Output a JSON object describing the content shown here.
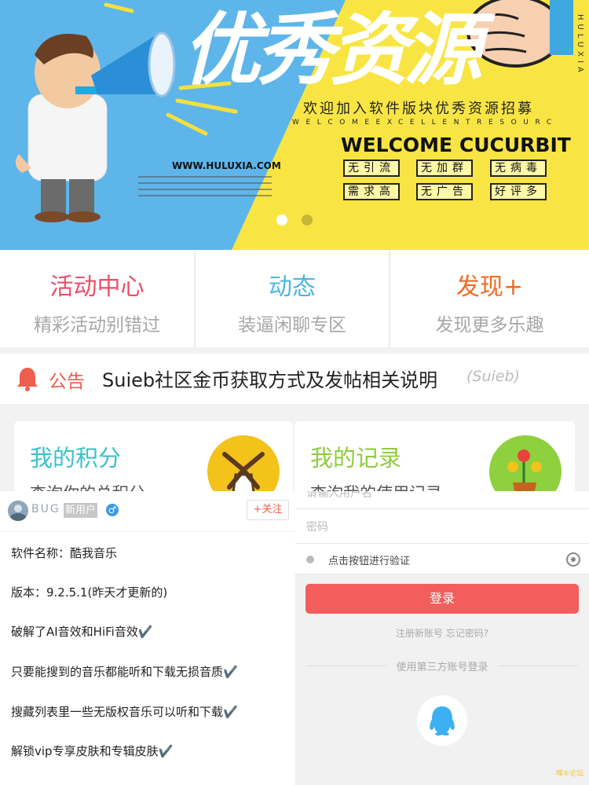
{
  "banner": {
    "title": "优秀资源",
    "side_text": "HULUXIA",
    "welcome_cn": "欢迎加入软件版块优秀资源招募",
    "welcome_en_spaced": "WELCOMEEXCELLENTRESOURC",
    "welcome_en": "WELCOME CUCURBIT",
    "site": "WWW.HULUXIA.COM",
    "tags": [
      "无引流",
      "无加群",
      "无病毒",
      "需求高",
      "无广告",
      "好评多"
    ],
    "active_slide": 1,
    "slide_count": 2,
    "colors": {
      "left": "#5eb5ea",
      "right": "#f8e544"
    }
  },
  "quicknav": [
    {
      "title": "活动中心",
      "subtitle": "精彩活动别错过",
      "color": "#ef4c6a"
    },
    {
      "title": "动态",
      "subtitle": "装逼闲聊专区",
      "color": "#4cb5e0"
    },
    {
      "title": "发现+",
      "subtitle": "发现更多乐趣",
      "color": "#f26b21"
    }
  ],
  "notice": {
    "label": "公告",
    "text": "Suieb社区金币获取方式及发帖相关说明",
    "author": "(Suieb)"
  },
  "cards": [
    {
      "title": "我的积分",
      "subtitle": "查询你的总积分",
      "icon": "windmill-icon",
      "circle_color": "#f3c21b"
    },
    {
      "title": "我的记录",
      "subtitle": "查询我的使用记录",
      "icon": "flower-pot-icon",
      "circle_color": "#8ed03d"
    }
  ],
  "post": {
    "username": "BUG",
    "badge": "新用户",
    "gender": "♂",
    "follow": "+关注",
    "lines": [
      "软件名称：酷我音乐",
      "版本：9.2.5.1(昨天才更新的)",
      "破解了AI音效和HiFi音效✔️",
      "只要能搜到的音乐都能听和下载无损音质✔️",
      "搜藏列表里一些无版权音乐可以听和下载✔️",
      "解锁vip专享皮肤和专辑皮肤✔️"
    ]
  },
  "login": {
    "account_placeholder": "请输入用户名",
    "password_placeholder": "密码",
    "captcha_text": "点击按钮进行验证",
    "login_button": "登录",
    "links": "注册新账号 忘记密码?",
    "third_party_title": "使用第三方账号登录",
    "watermark": "噗⑥论坛"
  }
}
